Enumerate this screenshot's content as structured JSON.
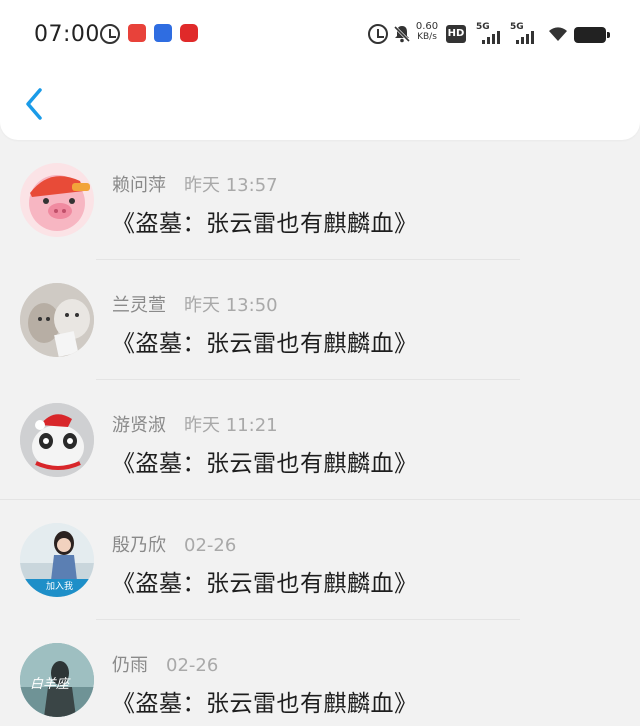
{
  "status_bar": {
    "time": "07:00",
    "net_speed_value": "0.60",
    "net_speed_unit": "KB/s",
    "hd_label": "HD",
    "sim1_label": "5G",
    "sim2_label": "5G",
    "icons": [
      "alarm-icon",
      "app-icon-red-1",
      "app-icon-blue",
      "app-icon-red-2",
      "alarm-icon",
      "mute-bell-icon",
      "hd-icon",
      "signal-icon",
      "signal-icon",
      "wifi-icon",
      "battery-icon"
    ]
  },
  "header": {
    "back_icon": "chevron-left-icon",
    "accent_color": "#1a9be8"
  },
  "conversations": [
    {
      "name": "赖问萍",
      "time": "昨天 13:57",
      "message": "《盗墓：张云雷也有麒麟血》",
      "avatar": "pink-pig-cap-avatar"
    },
    {
      "name": "兰灵萱",
      "time": "昨天 13:50",
      "message": "《盗墓：张云雷也有麒麟血》",
      "avatar": "two-cats-avatar"
    },
    {
      "name": "游贤淑",
      "time": "昨天 11:21",
      "message": "《盗墓：张云雷也有麒麟血》",
      "avatar": "cat-santa-hat-avatar"
    },
    {
      "name": "殷乃欣",
      "time": "02-26",
      "message": "《盗墓：张云雷也有麒麟血》",
      "avatar": "girl-photo-avatar",
      "avatar_text": "加入我"
    },
    {
      "name": "仍雨",
      "time": "02-26",
      "message": "《盗墓：张云雷也有麒麟血》",
      "avatar": "aries-avatar",
      "avatar_text": "白羊座"
    }
  ]
}
